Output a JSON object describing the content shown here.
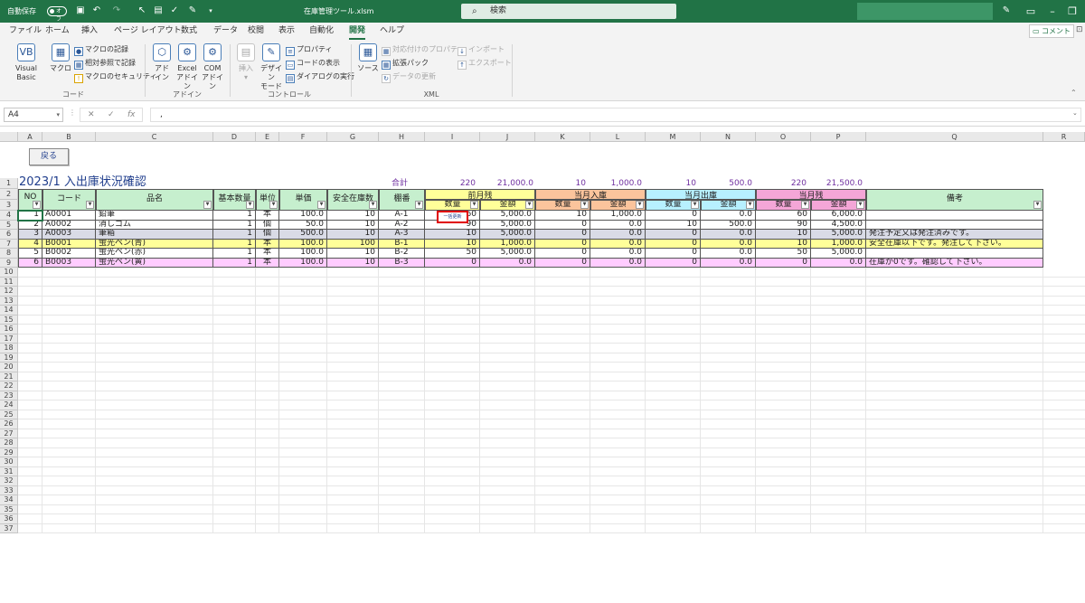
{
  "titlebar": {
    "autosave": "自動保存",
    "toggle": "オフ",
    "filename": "在庫管理ツール.xlsm",
    "search_placeholder": "検索"
  },
  "ribbon_tabs": [
    {
      "label": "ファイル"
    },
    {
      "label": "ホーム"
    },
    {
      "label": "挿入"
    },
    {
      "label": "ページ レイアウト"
    },
    {
      "label": "数式"
    },
    {
      "label": "データ"
    },
    {
      "label": "校閲"
    },
    {
      "label": "表示"
    },
    {
      "label": "自動化"
    },
    {
      "label": "開発"
    },
    {
      "label": "ヘルプ"
    }
  ],
  "comment_button": "コメント",
  "ribbon": {
    "code": {
      "visual_basic": "Visual Basic",
      "macro": "マクロ",
      "record": "マクロの記録",
      "relative": "相対参照で記録",
      "security": "マクロのセキュリティ",
      "group_label": "コード"
    },
    "addins": {
      "addin_1": "アド",
      "addin_2": "イン",
      "excel_1": "Excel",
      "excel_2": "アドイン",
      "com_1": "COM",
      "com_2": "アドイン",
      "group_label": "アドイン"
    },
    "controls": {
      "insert": "挿入",
      "design_1": "デザイン",
      "design_2": "モード",
      "properties": "プロパティ",
      "view_code": "コードの表示",
      "run_dialog": "ダイアログの実行",
      "group_label": "コントロール"
    },
    "xml": {
      "source": "ソース",
      "map_props": "対応付けのプロパティ",
      "ext_pack": "拡張パック",
      "refresh": "データの更新",
      "import": "インポート",
      "export": "エクスポート",
      "group_label": "XML"
    }
  },
  "formula_bar": {
    "name_box": "A4",
    "fx": "fx",
    "value": ","
  },
  "columns": [
    "A",
    "B",
    "C",
    "D",
    "E",
    "F",
    "G",
    "H",
    "I",
    "J",
    "K",
    "L",
    "M",
    "N",
    "O",
    "P",
    "Q",
    "R"
  ],
  "rows": [
    "1",
    "2",
    "3",
    "4",
    "5",
    "6",
    "7",
    "8",
    "9",
    "10",
    "11",
    "12",
    "13",
    "14",
    "15",
    "16",
    "17",
    "18",
    "19",
    "20",
    "21",
    "22",
    "23",
    "24",
    "25",
    "26",
    "27",
    "28",
    "29",
    "30",
    "31",
    "32",
    "33",
    "34",
    "35",
    "36",
    "37"
  ],
  "sheet": {
    "back_button": "戻る",
    "title": "2023/1  入出庫状況確認",
    "totals": {
      "label": "合計",
      "prev_qty": "220",
      "prev_amt": "21,000.0",
      "in_qty": "10",
      "in_amt": "1,000.0",
      "out_qty": "10",
      "out_amt": "500.0",
      "cur_qty": "220",
      "cur_amt": "21,500.0"
    },
    "headers": {
      "no": "NO",
      "code": "コード",
      "name": "品名",
      "base_qty": "基本数量",
      "unit": "単位",
      "price": "単価",
      "safety": "安全在庫数",
      "shelf": "棚番",
      "prev": "前月残",
      "in": "当月入庫",
      "out": "当月出庫",
      "cur": "当月残",
      "qty": "数量",
      "amt": "金額",
      "remarks": "備考"
    },
    "update_button": "一括更新",
    "items": [
      {
        "no": "1",
        "code": "A0001",
        "name": "鉛筆",
        "base": "1",
        "unit": "本",
        "price": "100.0",
        "safety": "10",
        "shelf": "A-1",
        "pq": "60",
        "pa": "5,000.0",
        "iq": "10",
        "ia": "1,000.0",
        "oq": "0",
        "oa": "0.0",
        "cq": "60",
        "ca": "6,000.0",
        "note": ""
      },
      {
        "no": "2",
        "code": "A0002",
        "name": "消しゴム",
        "base": "1",
        "unit": "個",
        "price": "50.0",
        "safety": "10",
        "shelf": "A-2",
        "pq": "90",
        "pa": "5,000.0",
        "iq": "0",
        "ia": "0.0",
        "oq": "10",
        "oa": "500.0",
        "cq": "90",
        "ca": "4,500.0",
        "note": ""
      },
      {
        "no": "3",
        "code": "A0003",
        "name": "筆箱",
        "base": "1",
        "unit": "個",
        "price": "500.0",
        "safety": "10",
        "shelf": "A-3",
        "pq": "10",
        "pa": "5,000.0",
        "iq": "0",
        "ia": "0.0",
        "oq": "0",
        "oa": "0.0",
        "cq": "10",
        "ca": "5,000.0",
        "note": "発注予定又は発注済みです。"
      },
      {
        "no": "4",
        "code": "B0001",
        "name": "蛍光ペン(青)",
        "base": "1",
        "unit": "本",
        "price": "100.0",
        "safety": "100",
        "shelf": "B-1",
        "pq": "10",
        "pa": "1,000.0",
        "iq": "0",
        "ia": "0.0",
        "oq": "0",
        "oa": "0.0",
        "cq": "10",
        "ca": "1,000.0",
        "note": "安全在庫以下です。発注して下さい。"
      },
      {
        "no": "5",
        "code": "B0002",
        "name": "蛍光ペン(赤)",
        "base": "1",
        "unit": "本",
        "price": "100.0",
        "safety": "10",
        "shelf": "B-2",
        "pq": "50",
        "pa": "5,000.0",
        "iq": "0",
        "ia": "0.0",
        "oq": "0",
        "oa": "0.0",
        "cq": "50",
        "ca": "5,000.0",
        "note": ""
      },
      {
        "no": "6",
        "code": "B0003",
        "name": "蛍光ペン(黄)",
        "base": "1",
        "unit": "本",
        "price": "100.0",
        "safety": "10",
        "shelf": "B-3",
        "pq": "0",
        "pa": "0.0",
        "iq": "0",
        "ia": "0.0",
        "oq": "0",
        "oa": "0.0",
        "cq": "0",
        "ca": "0.0",
        "note": "在庫が0です。確認して下さい。"
      }
    ]
  },
  "colors": {
    "excel_green": "#217346",
    "header_green": "#c6efce",
    "prev_yellow": "#ffff99",
    "in_orange": "#fbc49c",
    "out_cyan": "#b7f0ff",
    "cur_pink": "#f4a6d7",
    "row_grey": "#d9dbe6",
    "row_yellow": "#ffff99",
    "row_pink": "#ffccff",
    "title_blue": "#1f3d8c",
    "total_purple": "#7030a0"
  }
}
